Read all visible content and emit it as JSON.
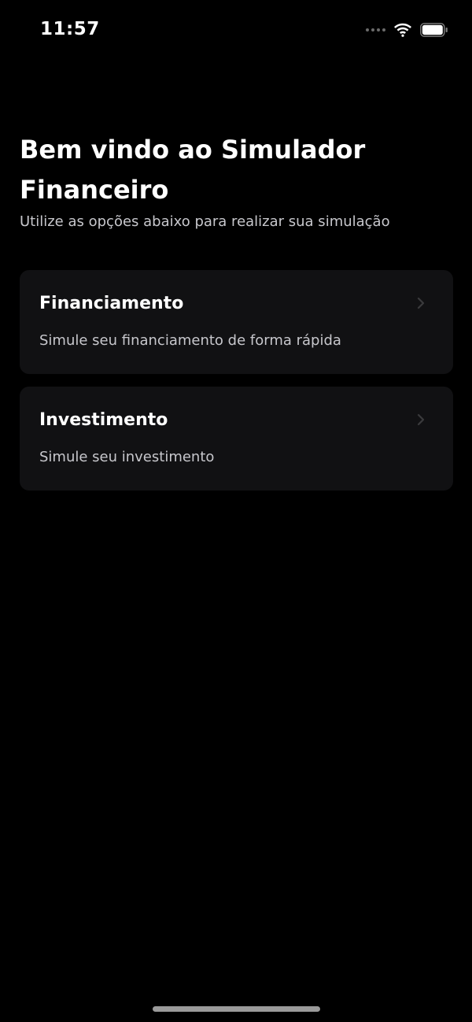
{
  "status_bar": {
    "time": "11:57",
    "icons": [
      "signal-dots-icon",
      "wifi-icon",
      "battery-icon"
    ]
  },
  "header": {
    "title": "Bem vindo ao Simulador Financeiro",
    "subtitle": "Utilize as opções abaixo para realizar sua simulação"
  },
  "options": [
    {
      "title": "Financiamento",
      "description": "Simule seu financiamento de forma rápida",
      "icon": "chevron-right-icon"
    },
    {
      "title": "Investimento",
      "description": "Simule seu investimento",
      "icon": "chevron-right-icon"
    }
  ],
  "colors": {
    "background": "#000000",
    "card": "#111113",
    "text_primary": "#ffffff",
    "text_secondary": "#c7c7cc",
    "chevron": "#3a3a3c"
  }
}
